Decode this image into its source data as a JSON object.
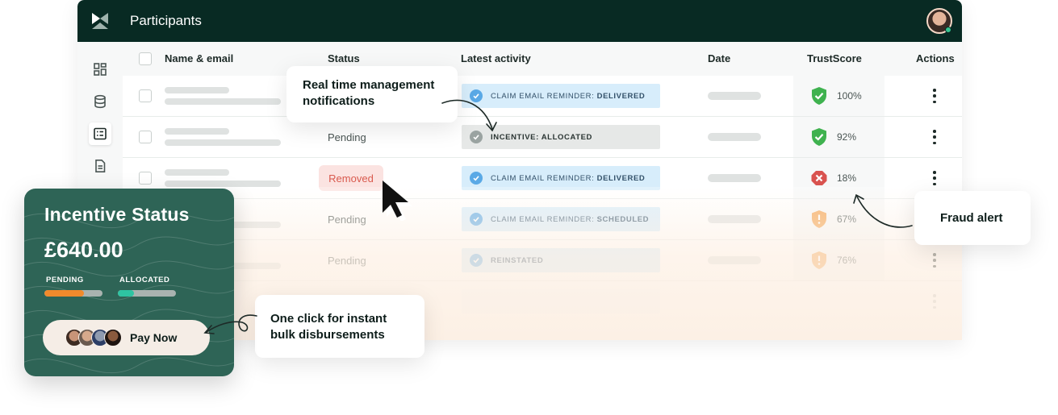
{
  "app": {
    "title": "Participants",
    "logo_icon": "brand-logo-icon",
    "avatar_icon": "user-avatar-icon"
  },
  "sidebar": {
    "items": [
      {
        "icon": "dashboard-grid-icon",
        "active": false
      },
      {
        "icon": "database-icon",
        "active": false
      },
      {
        "icon": "list-check-icon",
        "active": true
      },
      {
        "icon": "document-icon",
        "active": false
      }
    ]
  },
  "table": {
    "headers": {
      "name": "Name & email",
      "status": "Status",
      "activity": "Latest activity",
      "date": "Date",
      "trust": "TrustScore",
      "actions": "Actions"
    },
    "rows": [
      {
        "status": "",
        "activity_prefix": "CLAIM EMAIL REMINDER: ",
        "activity_bold": "DELIVERED",
        "activity_style": "blue",
        "trust": "100%",
        "trust_icon": "shield-check-icon"
      },
      {
        "status": "Pending",
        "activity_prefix": "",
        "activity_bold": "INCENTIVE: ALLOCATED",
        "activity_style": "grey",
        "trust": "92%",
        "trust_icon": "shield-check-icon"
      },
      {
        "status": "Removed",
        "activity_prefix": "CLAIM EMAIL REMINDER: ",
        "activity_bold": "DELIVERED",
        "activity_style": "blue",
        "trust": "18%",
        "trust_icon": "alert-x-icon"
      },
      {
        "status": "Pending",
        "activity_prefix": "CLAIM EMAIL REMINDER: ",
        "activity_bold": "SCHEDULED",
        "activity_style": "blue",
        "trust": "67%",
        "trust_icon": "shield-warning-icon"
      },
      {
        "status": "Pending",
        "activity_prefix": "",
        "activity_bold": "REINSTATED",
        "activity_style": "blue",
        "trust": "76%",
        "trust_icon": "shield-warning-icon"
      }
    ]
  },
  "callouts": {
    "realtime": "Real time management notifications",
    "fraud": "Fraud alert",
    "bulk": "One click for instant bulk disbursements"
  },
  "incentive_card": {
    "title": "Incentive Status",
    "amount": "£640.00",
    "pending_label": "PENDING",
    "allocated_label": "ALLOCATED",
    "pending_progress": 0.68,
    "allocated_progress": 0.28,
    "pay_button": "Pay Now"
  },
  "colors": {
    "topbar": "#082a23",
    "card": "#2e6456",
    "pending_bar": "#f08a2c",
    "allocated_bar": "#2ec4a2",
    "trust_good": "#3fb24f",
    "trust_bad": "#d9534f",
    "trust_warn": "#f3a04a"
  }
}
